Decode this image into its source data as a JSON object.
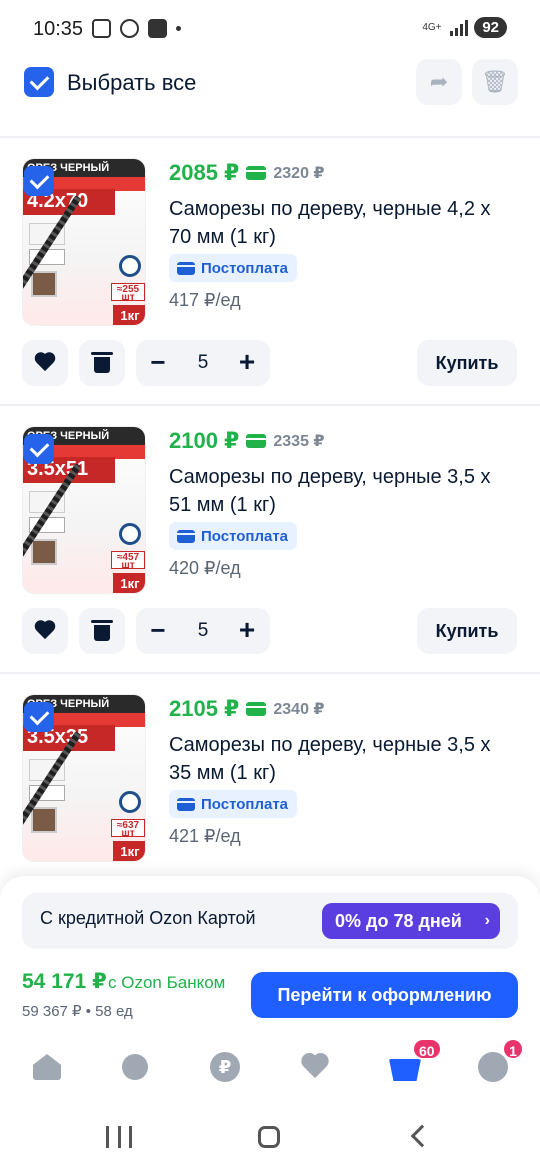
{
  "status_bar": {
    "time": "10:35",
    "network": "4G+",
    "battery": "92"
  },
  "header": {
    "select_all_label": "Выбрать все",
    "select_all_checked": true,
    "share_icon": "share-icon",
    "delete_icon": "trash-icon"
  },
  "products": [
    {
      "checked": true,
      "image_band": "ОРЕЗ ЧЕРНЫЙ",
      "image_size": "4.2x70",
      "image_count": "≈255 шт",
      "image_weight": "1кг",
      "price": "2085 ₽",
      "old_price": "2320 ₽",
      "title": "Саморезы по дереву, черные 4,2 х 70 мм (1 кг)",
      "postpay_label": "Постоплата",
      "unit_price": "417 ₽/ед",
      "quantity": "5",
      "buy_label": "Купить"
    },
    {
      "checked": true,
      "image_band": "ОРЕЗ ЧЕРНЫЙ",
      "image_size": "3.5x51",
      "image_count": "≈457 шт",
      "image_weight": "1кг",
      "price": "2100 ₽",
      "old_price": "2335 ₽",
      "title": "Саморезы по дереву, черные 3,5 х 51 мм (1 кг)",
      "postpay_label": "Постоплата",
      "unit_price": "420 ₽/ед",
      "quantity": "5",
      "buy_label": "Купить"
    },
    {
      "checked": true,
      "image_band": "ОРЕЗ ЧЕРНЫЙ",
      "image_size": "3.5x35",
      "image_count": "≈637 шт",
      "image_weight": "1кг",
      "price": "2105 ₽",
      "old_price": "2340 ₽",
      "title": "Саморезы по дереву, черные 3,5 х 35 мм (1 кг)",
      "postpay_label": "Постоплата",
      "unit_price": "421 ₽/ед"
    }
  ],
  "checkout": {
    "credit_text": "С кредитной Ozon Картой",
    "credit_offer": "0% до 78 дней",
    "credit_arrow": "›",
    "total_price": "54 171 ₽",
    "total_bank": "с Ozon Банком",
    "total_sub": "59 367 ₽ • 58 ед",
    "checkout_label": "Перейти к оформлению"
  },
  "tabbar": {
    "items": [
      {
        "icon": "home-icon"
      },
      {
        "icon": "fresh-icon"
      },
      {
        "icon": "ruble-icon",
        "glyph": "₽"
      },
      {
        "icon": "favorites-icon"
      },
      {
        "icon": "cart-icon",
        "badge": "60"
      },
      {
        "icon": "profile-icon",
        "badge": "1"
      }
    ]
  },
  "colors": {
    "accent": "#1f5fff",
    "price_green": "#21b24a",
    "checkbox": "#2563eb",
    "credit_purple": "#5b3ee0",
    "badge_pink": "#e8336b"
  }
}
